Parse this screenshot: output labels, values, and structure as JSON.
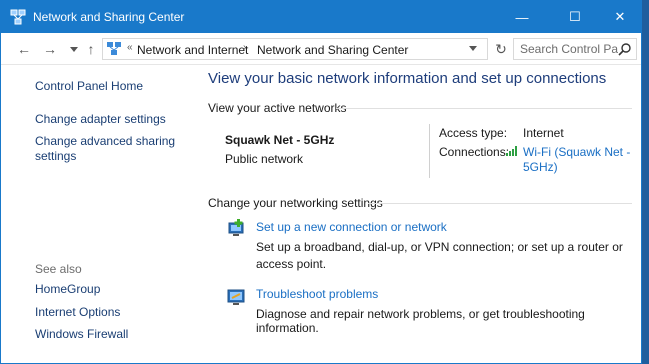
{
  "window": {
    "title": "Network and Sharing Center"
  },
  "title_controls": {
    "minimize": "—",
    "maximize": "☐",
    "close": "✕"
  },
  "nav": {
    "back": "←",
    "forward": "→",
    "up": "↑",
    "refresh": "↻"
  },
  "address": {
    "separator": "«",
    "crumbs": [
      "Network and Internet",
      "Network and Sharing Center"
    ],
    "crumb_separator": "›"
  },
  "search": {
    "placeholder": "Search Control Pa..."
  },
  "sidebar": {
    "home": "Control Panel Home",
    "adapter": "Change adapter settings",
    "advanced": "Change advanced sharing settings",
    "see_also": "See also",
    "homegroup": "HomeGroup",
    "internet_options": "Internet Options",
    "firewall": "Windows Firewall"
  },
  "main": {
    "title": "View your basic network information and set up connections",
    "active_label": "View your active networks",
    "network_name": "Squawk Net - 5GHz",
    "network_type": "Public network",
    "access_type_label": "Access type:",
    "access_type_value": "Internet",
    "connections_label": "Connections:",
    "connections_value": "Wi-Fi (Squawk Net - 5GHz)",
    "change_label": "Change your networking settings",
    "task1_link": "Set up a new connection or network",
    "task1_desc": "Set up a broadband, dial-up, or VPN connection; or set up a router or access point.",
    "task2_link": "Troubleshoot problems",
    "task2_desc": "Diagnose and repair network problems, or get troubleshooting information."
  },
  "colors": {
    "titlebar": "#1979ca",
    "link": "#1a6fc4",
    "heading": "#1e3d7b"
  }
}
